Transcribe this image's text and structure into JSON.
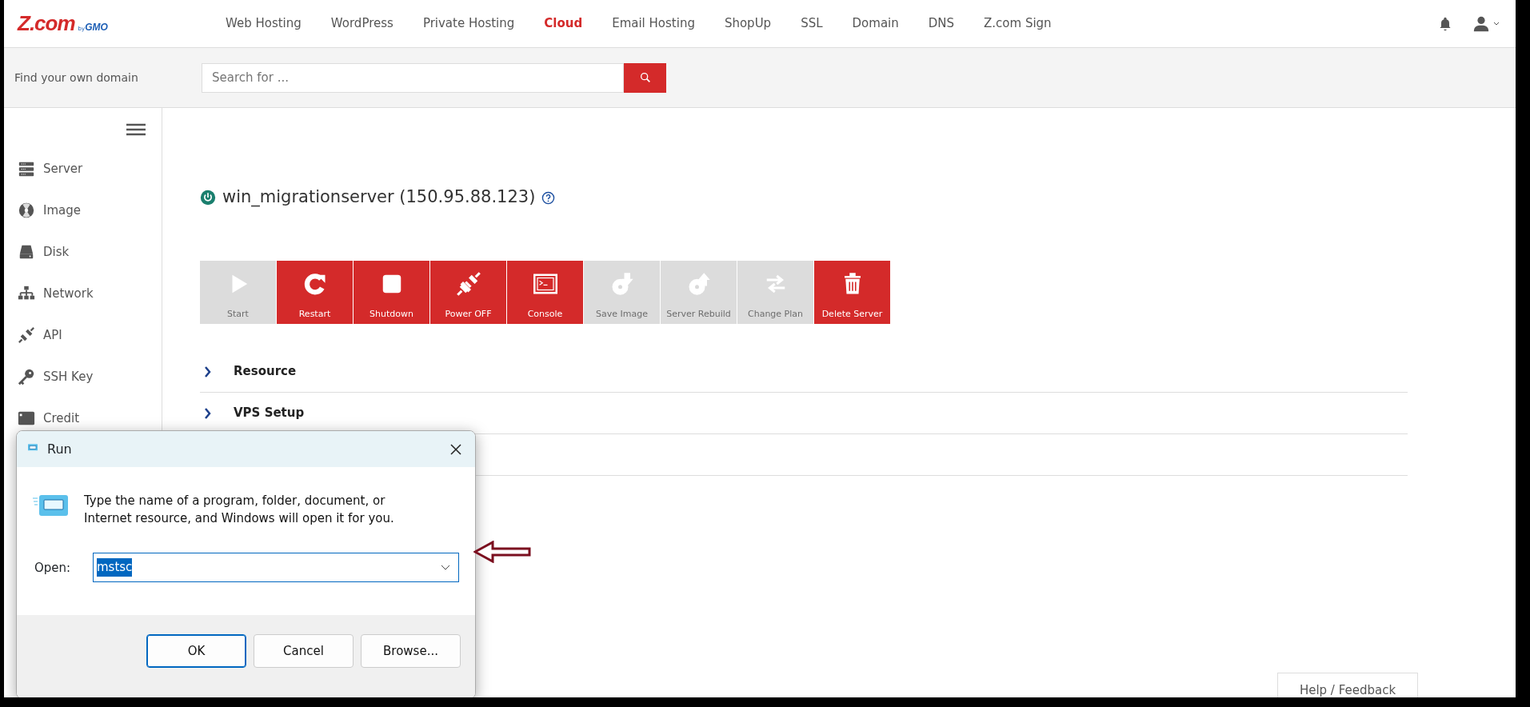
{
  "logo": {
    "brand": "Z.com",
    "by": "by",
    "company": "GMO"
  },
  "nav": [
    {
      "label": "Web Hosting",
      "selected": false
    },
    {
      "label": "WordPress",
      "selected": false
    },
    {
      "label": "Private Hosting",
      "selected": false
    },
    {
      "label": "Cloud",
      "selected": true
    },
    {
      "label": "Email Hosting",
      "selected": false
    },
    {
      "label": "ShopUp",
      "selected": false
    },
    {
      "label": "SSL",
      "selected": false
    },
    {
      "label": "Domain",
      "selected": false
    },
    {
      "label": "DNS",
      "selected": false
    },
    {
      "label": "Z.com Sign",
      "selected": false
    }
  ],
  "domain_search": {
    "label": "Find your own domain",
    "placeholder": "Search for ..."
  },
  "sidebar": {
    "items": [
      {
        "label": "Server"
      },
      {
        "label": "Image"
      },
      {
        "label": "Disk"
      },
      {
        "label": "Network"
      },
      {
        "label": "API"
      },
      {
        "label": "SSH Key"
      },
      {
        "label": "Credit"
      }
    ]
  },
  "server": {
    "name": "win_migrationserver (150.95.88.123)",
    "running": true
  },
  "actions": [
    {
      "label": "Start",
      "disabled": true
    },
    {
      "label": "Restart",
      "disabled": false
    },
    {
      "label": "Shutdown",
      "disabled": false
    },
    {
      "label": "Power OFF",
      "disabled": false
    },
    {
      "label": "Console",
      "disabled": false
    },
    {
      "label": "Save Image",
      "disabled": true
    },
    {
      "label": "Server Rebuild",
      "disabled": true
    },
    {
      "label": "Change Plan",
      "disabled": true
    },
    {
      "label": "Delete Server",
      "disabled": false
    }
  ],
  "sections": [
    {
      "label": "Resource",
      "expanded": false
    },
    {
      "label": "VPS Setup",
      "expanded": false
    }
  ],
  "run_dialog": {
    "title": "Run",
    "message": "Type the name of a program, folder, document, or Internet resource, and Windows will open it for you.",
    "open_label": "Open:",
    "value": "mstsc",
    "buttons": [
      {
        "label": "OK",
        "default": true
      },
      {
        "label": "Cancel",
        "default": false
      },
      {
        "label": "Browse...",
        "default": false
      }
    ]
  },
  "help_button": "Help / Feedback"
}
